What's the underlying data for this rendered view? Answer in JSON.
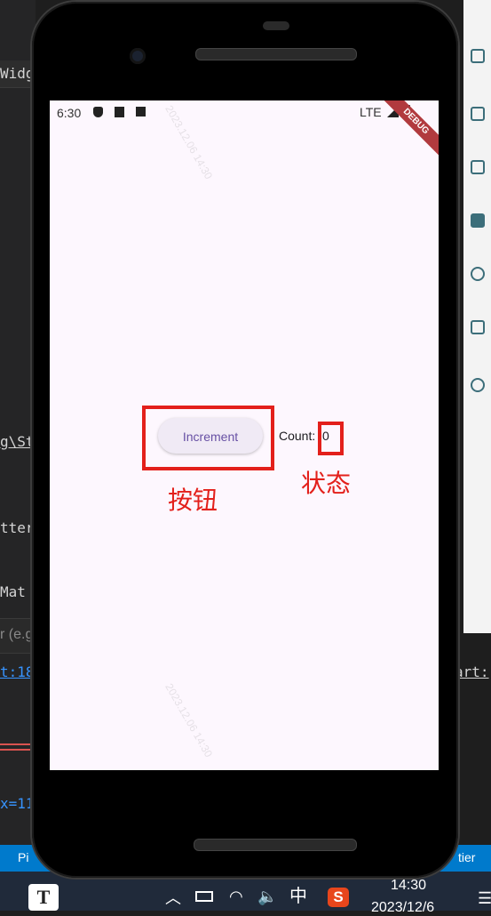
{
  "ide": {
    "left_snippets": [
      "Widg",
      "g\\St",
      "tter",
      "Mat",
      "r (e.g",
      "t:18",
      "x=11"
    ],
    "right_snippet": "art:",
    "status_left": "Pi",
    "status_right": "tier"
  },
  "phone": {
    "status_bar": {
      "time": "6:30",
      "network": "LTE"
    },
    "debug_banner": "DEBUG",
    "increment_button_label": "Increment",
    "count_label": "Count: ",
    "count_value": "0",
    "watermark": "2023.12.06 14:30"
  },
  "annotations": {
    "button_label": "按钮",
    "state_label": "状态"
  },
  "taskbar": {
    "app_letter": "T",
    "ime": "中",
    "sogou": "S",
    "time": "14:30",
    "date": "2023/12/6"
  },
  "colors": {
    "annotation_red": "#e3201b",
    "button_text": "#6750a4",
    "screen_bg": "#fdf7fe",
    "status_bar": "#007acc"
  }
}
